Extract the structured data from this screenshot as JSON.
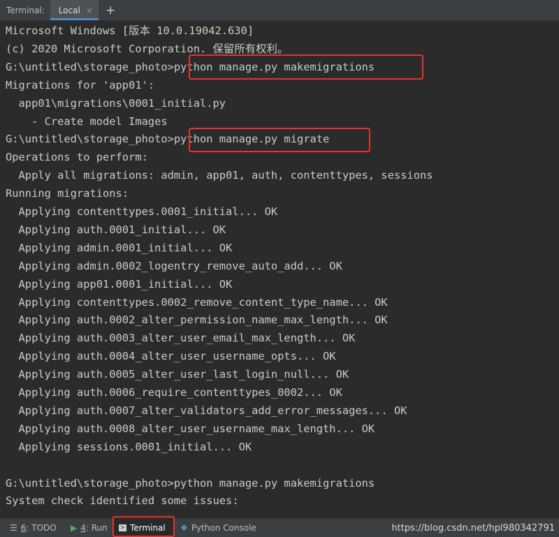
{
  "tab_bar": {
    "prefix": "Terminal:",
    "active_tab": "Local",
    "close_glyph": "×",
    "add_glyph": "+"
  },
  "terminal": {
    "lines": [
      "Microsoft Windows [版本 10.0.19042.630]",
      "(c) 2020 Microsoft Corporation. 保留所有权利。",
      "G:\\untitled\\storage_photo>python manage.py makemigrations",
      "Migrations for 'app01':",
      "  app01\\migrations\\0001_initial.py",
      "    - Create model Images",
      "G:\\untitled\\storage_photo>python manage.py migrate",
      "Operations to perform:",
      "  Apply all migrations: admin, app01, auth, contenttypes, sessions",
      "Running migrations:",
      "  Applying contenttypes.0001_initial... OK",
      "  Applying auth.0001_initial... OK",
      "  Applying admin.0001_initial... OK",
      "  Applying admin.0002_logentry_remove_auto_add... OK",
      "  Applying app01.0001_initial... OK",
      "  Applying contenttypes.0002_remove_content_type_name... OK",
      "  Applying auth.0002_alter_permission_name_max_length... OK",
      "  Applying auth.0003_alter_user_email_max_length... OK",
      "  Applying auth.0004_alter_user_username_opts... OK",
      "  Applying auth.0005_alter_user_last_login_null... OK",
      "  Applying auth.0006_require_contenttypes_0002... OK",
      "  Applying auth.0007_alter_validators_add_error_messages... OK",
      "  Applying auth.0008_alter_user_username_max_length... OK",
      "  Applying sessions.0001_initial... OK",
      "",
      "G:\\untitled\\storage_photo>python manage.py makemigrations",
      "System check identified some issues:"
    ]
  },
  "status_bar": {
    "todo": {
      "num": "6",
      "label": ": TODO",
      "icon": "list-icon"
    },
    "run": {
      "num": "4",
      "label": ": Run",
      "icon": "play-icon"
    },
    "terminal": {
      "label": "Terminal",
      "icon": "terminal-icon"
    },
    "python_console": {
      "label": "Python Console",
      "icon": "python-icon"
    },
    "watermark": "https://blog.csdn.net/hpl980342791"
  },
  "colors": {
    "background": "#2b2b2b",
    "text": "#c5cfc5",
    "highlight": "#e53232",
    "tab_accent": "#4a88c7"
  }
}
